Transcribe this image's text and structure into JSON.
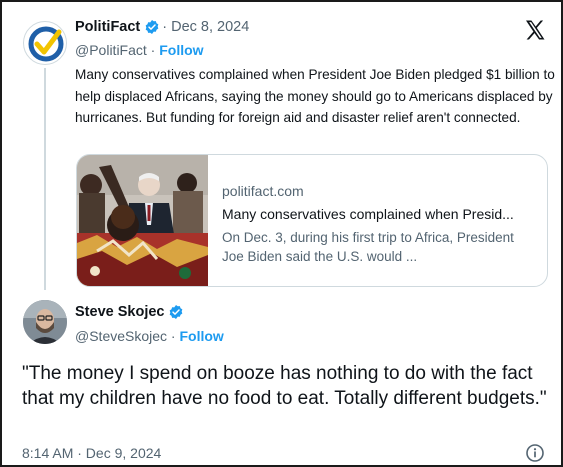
{
  "quoted": {
    "name": "PolitiFact",
    "separator_date": "· Dec 8, 2024",
    "handle": "@PolitiFact ·",
    "follow_label": "Follow",
    "text": "Many conservatives complained when President Joe Biden pledged $1 billion to help displaced Africans, saying the money should go to Americans displaced by hurricanes. But funding for foreign aid and disaster relief aren't connected.",
    "card": {
      "domain": "politifact.com",
      "title": "Many conservatives complained when Presid...",
      "description": "On Dec. 3, during his first trip to Africa, President Joe Biden said the U.S. would ..."
    }
  },
  "main": {
    "name": "Steve Skojec",
    "handle": "@SteveSkojec ·",
    "follow_label": "Follow",
    "text": "\"The money I spend on booze has nothing to do with the fact that my children have no food to eat. Totally different budgets.\"",
    "timestamp": "8:14 AM · Dec 9, 2024"
  },
  "icons": {
    "logo": "x-logo-icon",
    "verified": "verified-badge-icon",
    "info": "info-icon"
  },
  "colors": {
    "accent": "#1d9bf0",
    "politifact_blue": "#1f5fa8",
    "politifact_yellow": "#f2c400",
    "muted": "#536471"
  }
}
